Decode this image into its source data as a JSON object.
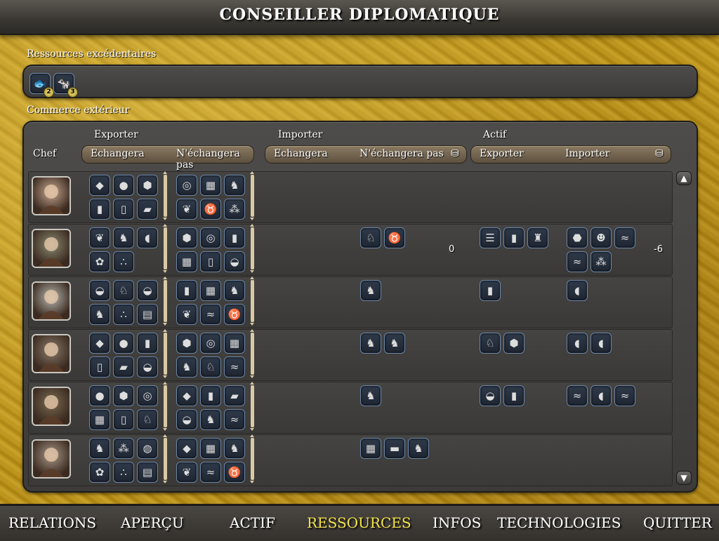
{
  "window": {
    "title": "CONSEILLER DIPLOMATIQUE"
  },
  "surplus": {
    "label": "Ressources excédentaires",
    "items": [
      {
        "icon": "fish-icon",
        "glyph": "🐟",
        "count": "2"
      },
      {
        "icon": "cattle-icon",
        "glyph": "🐄",
        "count": "3"
      }
    ]
  },
  "trade": {
    "label": "Commerce extérieur",
    "headers": {
      "chef": "Chef",
      "exporter": "Exporter",
      "importer": "Importer",
      "actif": "Actif",
      "echangera": "Echangera",
      "nechangera_pas": "N'échangera pas",
      "echangera2": "Echangera",
      "nechangera_pas2": "N'échangera pas",
      "actif_exporter": "Exporter",
      "actif_importer": "Importer"
    },
    "rows": [
      {
        "portrait": "portrait-ruler-1",
        "export_will": [
          "coal",
          "silver",
          "iron",
          "lead",
          "salt",
          "marble"
        ],
        "export_wont": [
          "copper",
          "wagon",
          "horse",
          "herbs",
          "cattle",
          "wheat"
        ],
        "import_will": [],
        "import_balance": "",
        "active_export": [],
        "active_import": [],
        "active_balance": ""
      },
      {
        "portrait": "portrait-ruler-2",
        "export_will": [
          "herbs",
          "horse",
          "bread",
          "dye",
          "spices"
        ],
        "export_wont": [
          "iron",
          "copper",
          "lead",
          "wagon",
          "salt",
          "oysters"
        ],
        "import_will": [
          "camel",
          "cattle"
        ],
        "import_balance": "0",
        "active_export": [
          "scroll",
          "lead",
          "wine"
        ],
        "active_import": [
          "stone",
          "trader",
          "fish",
          "fish",
          "wheat"
        ],
        "active_balance": "-6"
      },
      {
        "portrait": "portrait-ruler-3",
        "export_will": [
          "oysters",
          "camel",
          "oysters",
          "horse",
          "spices",
          "papyrus"
        ],
        "export_wont": [
          "lead",
          "wagon",
          "horse",
          "herbs",
          "fish",
          "cattle"
        ],
        "import_will": [
          "horse"
        ],
        "import_balance": "",
        "active_export": [
          "lead"
        ],
        "active_import": [
          "bread"
        ],
        "active_balance": ""
      },
      {
        "portrait": "portrait-ruler-4",
        "export_will": [
          "coal",
          "silver",
          "lead",
          "salt",
          "marble",
          "oysters"
        ],
        "export_wont": [
          "iron",
          "copper",
          "wagon",
          "horse",
          "camel",
          "fish"
        ],
        "import_will": [
          "horse",
          "horse"
        ],
        "import_balance": "",
        "active_export": [
          "camel",
          "iron"
        ],
        "active_import": [
          "bread",
          "bread"
        ],
        "active_balance": ""
      },
      {
        "portrait": "portrait-ruler-5",
        "export_will": [
          "silver",
          "iron",
          "copper",
          "wagon",
          "salt",
          "camel"
        ],
        "export_wont": [
          "coal",
          "lead",
          "marble",
          "oysters",
          "horse",
          "fish"
        ],
        "import_will": [
          "horse"
        ],
        "import_balance": "",
        "active_export": [
          "oysters",
          "lead"
        ],
        "active_import": [
          "fish",
          "bread",
          "fish"
        ],
        "active_balance": ""
      },
      {
        "portrait": "portrait-ruler-6",
        "export_will": [
          "horse",
          "wheat",
          "rice",
          "dye",
          "spices",
          "papyrus"
        ],
        "export_wont": [
          "coal",
          "wagon",
          "horse",
          "herbs",
          "fish",
          "cattle"
        ],
        "import_will": [
          "wagon",
          "gold",
          "horse"
        ],
        "import_balance": "",
        "active_export": [],
        "active_import": [],
        "active_balance": ""
      }
    ]
  },
  "icons": {
    "coal": "◆",
    "silver": "●",
    "iron": "⬢",
    "lead": "▮",
    "salt": "▯",
    "marble": "▰",
    "copper": "◎",
    "wagon": "▦",
    "horse": "♞",
    "herbs": "❦",
    "cattle": "♉",
    "wheat": "⁂",
    "bread": "◖",
    "dye": "✿",
    "spices": "∴",
    "oysters": "◒",
    "camel": "♘",
    "papyrus": "▤",
    "fish": "≈",
    "scroll": "☰",
    "wine": "♜",
    "stone": "⬣",
    "trader": "☻",
    "rice": "◍",
    "gold": "▬"
  },
  "nav": {
    "relations": "RELATIONS",
    "apercu": "APERÇU",
    "actif": "ACTIF",
    "ressources": "RESSOURCES",
    "infos": "INFOS",
    "technologies": "TECHNOLOGIES",
    "quitter": "QUITTER"
  },
  "colors": {
    "active_tab": "#f3e24a",
    "panel": "#3f3e3c",
    "background": "#b8901a"
  }
}
